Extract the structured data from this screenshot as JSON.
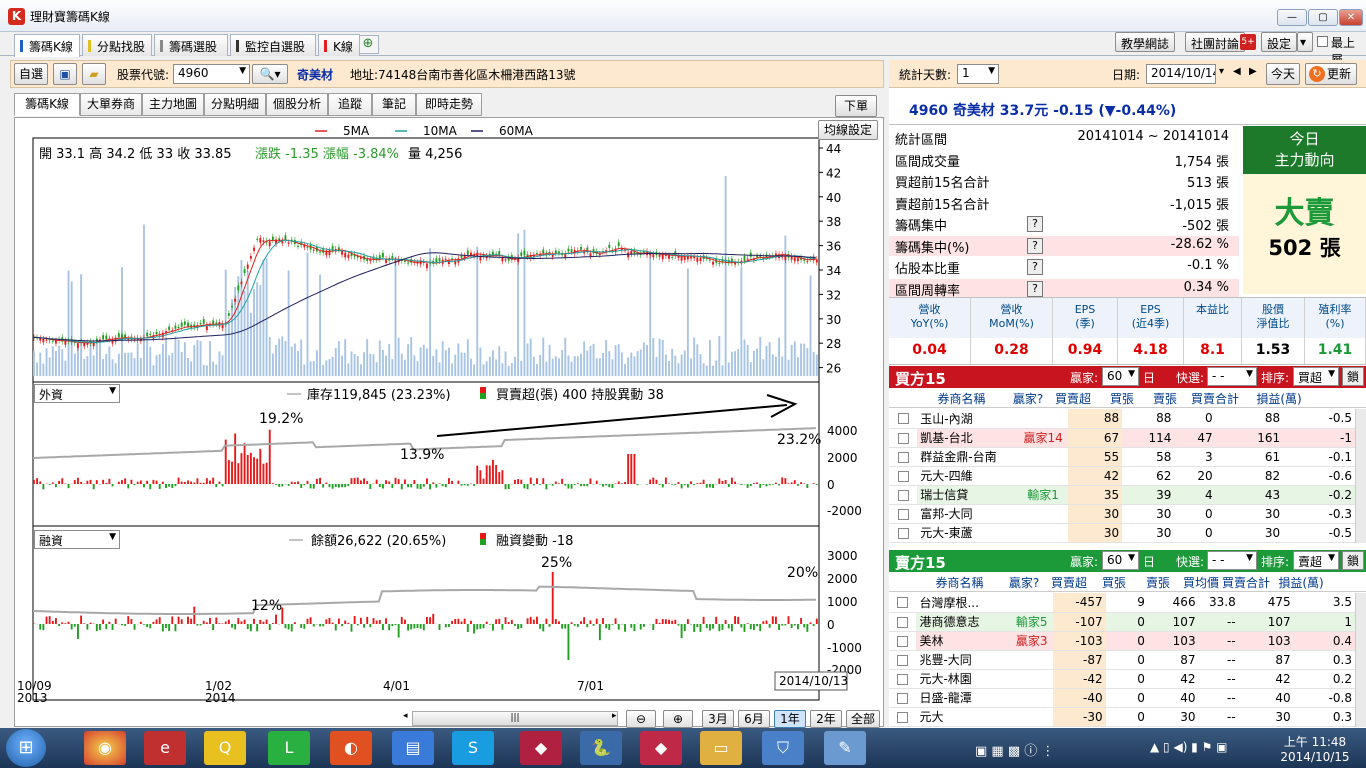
{
  "window": {
    "title": "理財寶籌碼K線",
    "app_icon": "K",
    "buttons": [
      "—",
      "▢",
      "✕"
    ]
  },
  "main_tabs": [
    {
      "label": "籌碼K線",
      "color": "#2060c0"
    },
    {
      "label": "分點找股",
      "color": "#e0c020"
    },
    {
      "label": "籌碼選股",
      "color": "#888888"
    },
    {
      "label": "監控自選股",
      "color": "#333333"
    },
    {
      "label": "K線",
      "color": "#e02020"
    }
  ],
  "top_buttons": {
    "forum": "教學網誌",
    "group": "社團討論",
    "settings": "設定",
    "topmost": "最上層"
  },
  "toolbar": {
    "watchlist": "自選",
    "code_label": "股票代號:",
    "code_value": "4960",
    "stock_name": "奇美材",
    "address": "地址:74148台南市善化區木柵港西路13號"
  },
  "sub_tabs": [
    "籌碼K線",
    "大單券商",
    "主力地圖",
    "分點明細",
    "個股分析",
    "追蹤",
    "筆記",
    "即時走勢"
  ],
  "sub_tab_right": "下單",
  "chart": {
    "ma_settings": "均線設定",
    "legend": [
      {
        "label": "5MA",
        "color": "#e02020"
      },
      {
        "label": "10MA",
        "color": "#20a0a0"
      },
      {
        "label": "60MA",
        "color": "#202060"
      }
    ],
    "ohlc_text": "開 33.1  高 34.2  低 33  收 33.85",
    "change_text": "漲跌 -1.35  漲幅  -3.84%",
    "volume_text": "量 4,256",
    "price_ticks": [
      "44",
      "42",
      "40",
      "38",
      "36",
      "34",
      "32",
      "30",
      "28",
      "26"
    ],
    "foreign": {
      "selector": "外資",
      "inventory": "庫存119,845 (23.23%)",
      "net": "買賣超(張) 400 持股異動 38",
      "ticks": [
        "4000",
        "2000",
        "0",
        "-2000"
      ],
      "annotations": [
        "19.2%",
        "13.9%",
        "23.2%"
      ]
    },
    "margin": {
      "selector": "融資",
      "balance": "餘額26,622 (20.65%)",
      "change": "融資變動 -18",
      "ticks": [
        "3000",
        "2000",
        "1000",
        "0",
        "-1000",
        "-2000"
      ],
      "annotations": [
        "12%",
        "25%",
        "20%"
      ]
    },
    "x_labels": [
      {
        "top": "10/09",
        "bottom": "2013"
      },
      {
        "top": "1/02",
        "bottom": "2014"
      },
      {
        "top": "4/01",
        "bottom": ""
      },
      {
        "top": "7/01",
        "bottom": ""
      }
    ],
    "cursor_date": "2014/10/13",
    "range_buttons": [
      "3月",
      "6月",
      "1年",
      "2年",
      "全部"
    ],
    "range_active": "1年"
  },
  "right_panel": {
    "days_label": "統計天數:",
    "days_value": "1",
    "date_label": "日期:",
    "date_value": "2014/10/14",
    "today": "今天",
    "refresh": "更新",
    "quote": "4960 奇美材  33.7元  -0.15 (▼-0.44%)",
    "summary": [
      {
        "label": "統計區間",
        "value": "20141014 ~ 20141014",
        "help": false,
        "hl": false
      },
      {
        "label": "區間成交量",
        "value": "1,754 張",
        "help": false,
        "hl": false
      },
      {
        "label": "買超前15名合計",
        "value": "513 張",
        "help": false,
        "hl": false
      },
      {
        "label": "賣超前15名合計",
        "value": "-1,015 張",
        "help": false,
        "hl": false
      },
      {
        "label": "籌碼集中",
        "value": "-502 張",
        "help": true,
        "hl": false
      },
      {
        "label": "籌碼集中(%)",
        "value": "-28.62 %",
        "help": true,
        "hl": true
      },
      {
        "label": "佔股本比重",
        "value": "-0.1 %",
        "help": true,
        "hl": false
      },
      {
        "label": "區間周轉率",
        "value": "0.34 %",
        "help": true,
        "hl": true
      }
    ],
    "today_box": {
      "title1": "今日",
      "title2": "主力動向",
      "action": "大賣",
      "amount": "502 張"
    },
    "fin_headers": [
      [
        "營收",
        "YoY(%)"
      ],
      [
        "營收",
        "MoM(%)"
      ],
      [
        "EPS",
        "(季)"
      ],
      [
        "EPS",
        "(近4季)"
      ],
      [
        "本益比",
        ""
      ],
      [
        "股價",
        "淨值比"
      ],
      [
        "殖利率",
        "(%)"
      ]
    ],
    "fin_values": [
      "0.04",
      "0.28",
      "0.94",
      "4.18",
      "8.1",
      "1.53",
      "1.41"
    ],
    "buy": {
      "title": "買方15",
      "winner_label": "贏家:",
      "winner_value": "60",
      "day": "日",
      "quick_label": "快選:",
      "quick_value": "- -",
      "sort_label": "排序:",
      "sort_value": "買超",
      "lock": "鎖",
      "columns": [
        "券商名稱",
        "贏家?",
        "買賣超",
        "買張",
        "賣張",
        "買賣合計",
        "損益(萬)"
      ],
      "rows": [
        [
          "玉山-內湖",
          "",
          "88",
          "88",
          "0",
          "88",
          "-0.5"
        ],
        [
          "凱基-台北",
          "贏家14",
          "67",
          "114",
          "47",
          "161",
          "-1"
        ],
        [
          "群益金鼎-台南",
          "",
          "55",
          "58",
          "3",
          "61",
          "-0.1"
        ],
        [
          "元大-四維",
          "",
          "42",
          "62",
          "20",
          "82",
          "-0.6"
        ],
        [
          "瑞士信貸",
          "輸家1",
          "35",
          "39",
          "4",
          "43",
          "-0.2"
        ],
        [
          "富邦-大同",
          "",
          "30",
          "30",
          "0",
          "30",
          "-0.3"
        ],
        [
          "元大-東蘆",
          "",
          "30",
          "30",
          "0",
          "30",
          "-0.5"
        ]
      ]
    },
    "sell": {
      "title": "賣方15",
      "winner_label": "贏家:",
      "winner_value": "60",
      "day": "日",
      "quick_label": "快選:",
      "quick_value": "- -",
      "sort_label": "排序:",
      "sort_value": "賣超",
      "lock": "鎖",
      "columns": [
        "券商名稱",
        "贏家?",
        "買賣超",
        "買張",
        "賣張",
        "買均價",
        "買賣合計",
        "損益(萬)"
      ],
      "rows": [
        [
          "台灣摩根...",
          "",
          "-457",
          "9",
          "466",
          "33.8",
          "475",
          "3.5"
        ],
        [
          "港商德意志",
          "輸家5",
          "-107",
          "0",
          "107",
          "--",
          "107",
          "1"
        ],
        [
          "美林",
          "贏家3",
          "-103",
          "0",
          "103",
          "--",
          "103",
          "0.4"
        ],
        [
          "兆豐-大同",
          "",
          "-87",
          "0",
          "87",
          "--",
          "87",
          "0.3"
        ],
        [
          "元大-林園",
          "",
          "-42",
          "0",
          "42",
          "--",
          "42",
          "0.2"
        ],
        [
          "日盛-龍潭",
          "",
          "-40",
          "0",
          "40",
          "--",
          "40",
          "-0.8"
        ],
        [
          "元大",
          "",
          "-30",
          "0",
          "30",
          "--",
          "30",
          "0.3"
        ]
      ]
    }
  },
  "taskbar": {
    "time": "上午 11:48",
    "date": "2014/10/15"
  }
}
